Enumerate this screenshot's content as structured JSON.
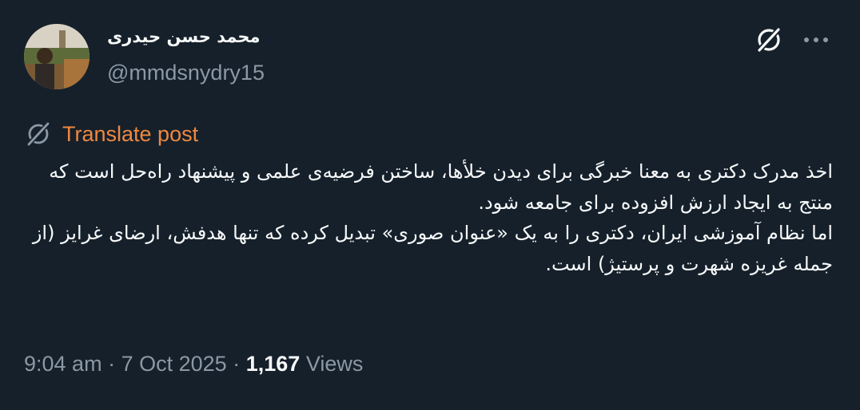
{
  "author": {
    "display_name": "محمد حسن حیدری",
    "handle": "@mmdsnydry15"
  },
  "translate": {
    "label": "Translate post"
  },
  "post": {
    "text": "اخذ مدرک دکتری به معنا خبرگی برای دیدن خلأها، ساختن فرضیه‌ی علمی و پیشنهاد راه‌حل است که منتج به ایجاد ارزش افزوده برای جامعه شود.\nاما نظام آموزشی ایران، دکتری را به یک «عنوان صوری» تبدیل کرده که تنها هدفش، ارضای غرایز (از جمله غریزه شهرت و پرستیژ) است."
  },
  "meta": {
    "time": "9:04 am",
    "separator": "·",
    "date": "7 Oct 2025",
    "views_count": "1,167",
    "views_label": "Views"
  },
  "colors": {
    "background": "#15202b",
    "text_primary": "#f7f9f9",
    "text_secondary": "#8b98a5",
    "translate_accent": "#f0883e"
  },
  "icons": {
    "grok": "grok-icon",
    "more": "more-icon",
    "translate": "translate-icon"
  }
}
